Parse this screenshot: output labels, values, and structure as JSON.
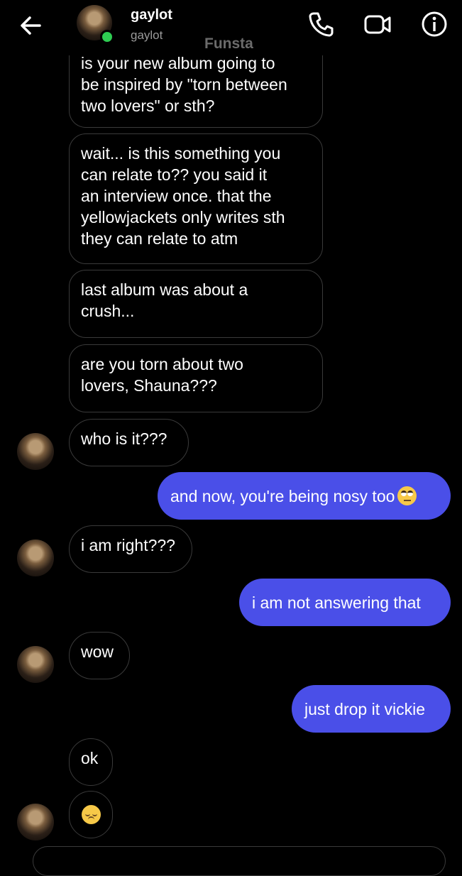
{
  "header": {
    "contact_name": "gaylot",
    "contact_handle": "gaylot",
    "account_label": "Funsta",
    "online_color": "#2ecc52",
    "icons": [
      "back-arrow-icon",
      "phone-icon",
      "video-call-icon",
      "info-icon"
    ]
  },
  "messages": [
    {
      "side": "in",
      "text": "is your new album going to\nbe inspired by \"torn between\ntwo lovers\" or sth?"
    },
    {
      "side": "in",
      "text": "wait... is this something you\ncan relate to?? you said it\nan interview once. that the\nyellowjackets only writes sth\nthey can relate to atm"
    },
    {
      "side": "in",
      "text": "last album was about a\ncrush..."
    },
    {
      "side": "in",
      "text": "are you torn about two\nlovers, Shauna???"
    },
    {
      "side": "in",
      "text": "who is it???"
    },
    {
      "side": "out",
      "text": "and now, you're being nosy too",
      "emoji": "face-with-rolling-eyes"
    },
    {
      "side": "in",
      "text": "i am right???"
    },
    {
      "side": "out",
      "text": "i am not answering that"
    },
    {
      "side": "in",
      "text": "wow"
    },
    {
      "side": "out",
      "text": "just drop it vickie"
    },
    {
      "side": "in",
      "text": "ok"
    },
    {
      "side": "in",
      "text": "",
      "emoji": "pensive-face"
    }
  ],
  "colors": {
    "outgoing_bubble": "#4a4fe8",
    "background": "#000000",
    "incoming_border": "#3a3a3a"
  }
}
